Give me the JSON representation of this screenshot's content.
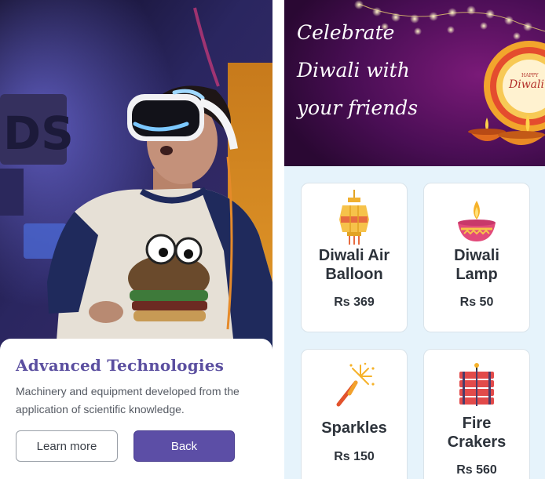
{
  "left_card": {
    "title": "Advanced Technologies",
    "description": "Machinery and equipment developed from the application of scientific knowledge.",
    "learn_more_label": "Learn more",
    "back_label": "Back"
  },
  "right_app": {
    "banner": {
      "lines": [
        "Celebrate",
        "Diwali with",
        "your friends"
      ],
      "badge_small": "HAPPY",
      "badge_big": "Diwali"
    },
    "products": [
      {
        "name_line1": "Diwali Air",
        "name_line2": "Balloon",
        "price": "Rs 369",
        "icon": "lantern-icon"
      },
      {
        "name_line1": "Diwali",
        "name_line2": "Lamp",
        "price": "Rs 50",
        "icon": "diya-icon"
      },
      {
        "name_line1": "Sparkles",
        "name_line2": "",
        "price": "Rs 150",
        "icon": "sparkler-icon"
      },
      {
        "name_line1": "Fire",
        "name_line2": "Crakers",
        "price": "Rs 560",
        "icon": "firecracker-icon"
      }
    ]
  },
  "colors": {
    "accent_purple": "#5c4ea6",
    "title_purple": "#5b4fa0",
    "right_background": "#e6f3fb",
    "banner_purple": "#3d0d4a"
  }
}
